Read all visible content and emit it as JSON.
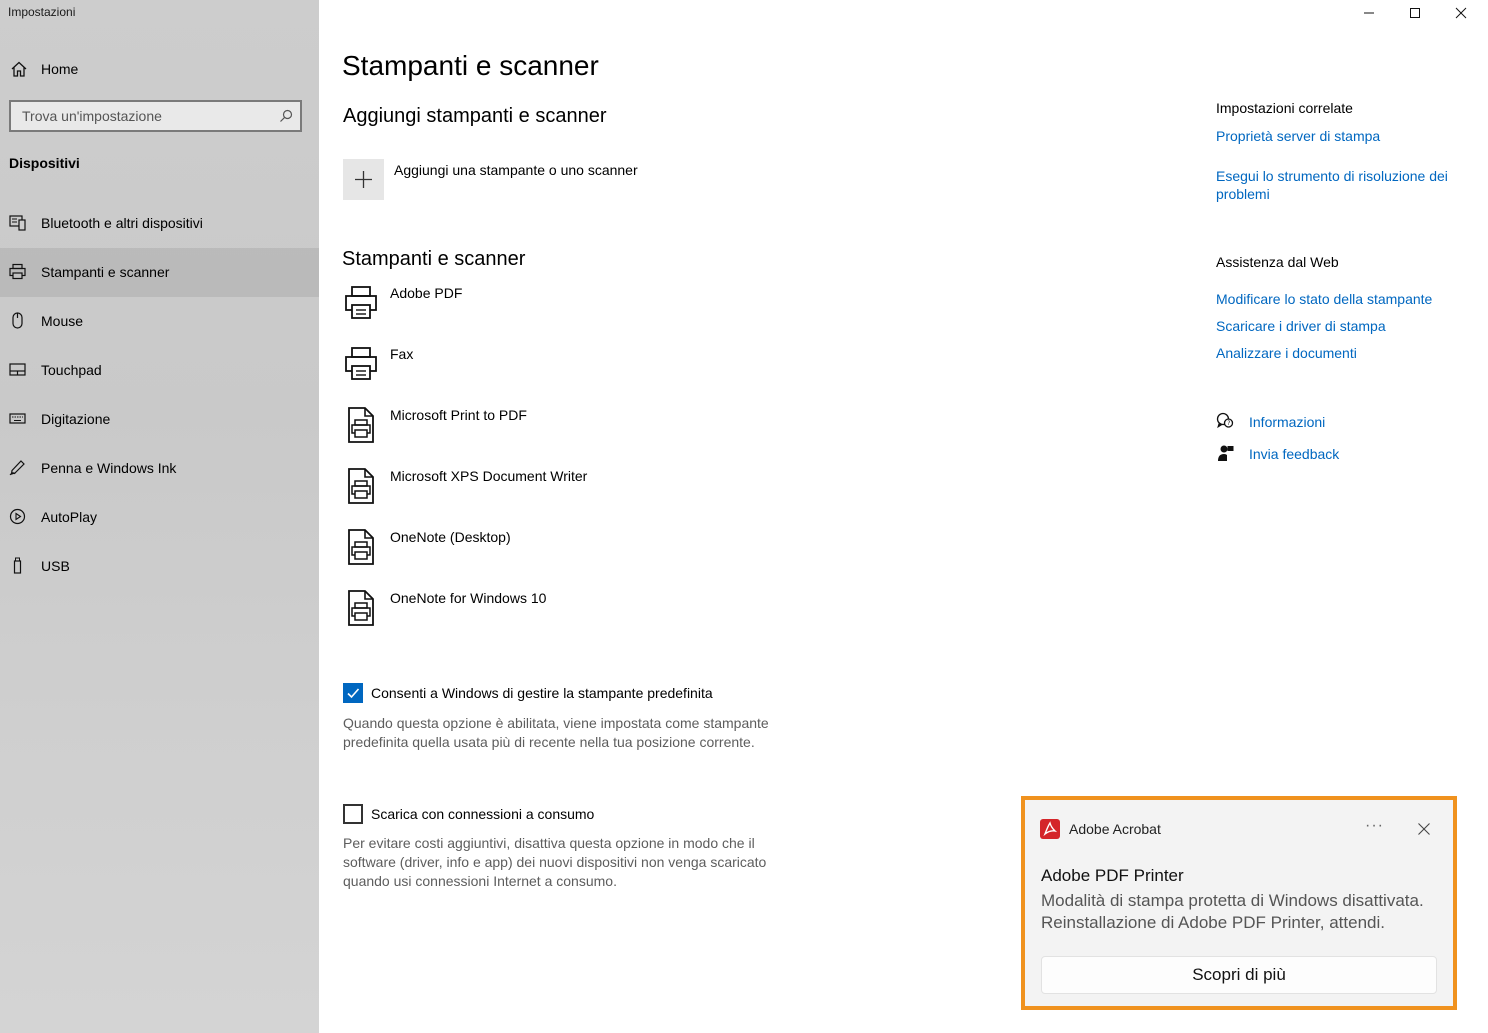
{
  "window": {
    "title": "Impostazioni",
    "controls": [
      "minimize-icon",
      "maximize-icon",
      "close-icon"
    ]
  },
  "sidebar": {
    "home_label": "Home",
    "search_placeholder": "Trova un'impostazione",
    "section_title": "Dispositivi",
    "items": [
      {
        "label": "Bluetooth e altri dispositivi",
        "icon": "bluetooth-devices-icon",
        "selected": false
      },
      {
        "label": "Stampanti e scanner",
        "icon": "printer-icon",
        "selected": true
      },
      {
        "label": "Mouse",
        "icon": "mouse-icon",
        "selected": false
      },
      {
        "label": "Touchpad",
        "icon": "touchpad-icon",
        "selected": false
      },
      {
        "label": "Digitazione",
        "icon": "keyboard-icon",
        "selected": false
      },
      {
        "label": "Penna e Windows Ink",
        "icon": "pen-icon",
        "selected": false
      },
      {
        "label": "AutoPlay",
        "icon": "autoplay-icon",
        "selected": false
      },
      {
        "label": "USB",
        "icon": "usb-icon",
        "selected": false
      }
    ]
  },
  "main": {
    "title": "Stampanti e scanner",
    "add_section_title": "Aggiungi stampanti e scanner",
    "add_button_label": "Aggiungi una stampante o uno scanner",
    "printers_section_title": "Stampanti e scanner",
    "printers": [
      {
        "name": "Adobe PDF",
        "icon": "printer-icon"
      },
      {
        "name": "Fax",
        "icon": "printer-icon"
      },
      {
        "name": "Microsoft Print to PDF",
        "icon": "document-printer-icon"
      },
      {
        "name": "Microsoft XPS Document Writer",
        "icon": "document-printer-icon"
      },
      {
        "name": "OneNote (Desktop)",
        "icon": "document-printer-icon"
      },
      {
        "name": "OneNote for Windows 10",
        "icon": "document-printer-icon"
      }
    ],
    "default_printer": {
      "checked": true,
      "label": "Consenti a Windows di gestire la stampante predefinita",
      "description": "Quando questa opzione è abilitata, viene impostata come stampante predefinita quella usata più di recente nella tua posizione corrente."
    },
    "metered": {
      "checked": false,
      "label": "Scarica con connessioni a consumo",
      "description": "Per evitare costi aggiuntivi, disattiva questa opzione in modo che il software (driver, info e app) dei nuovi dispositivi non venga scaricato quando usi connessioni Internet a consumo."
    }
  },
  "related": {
    "heading": "Impostazioni correlate",
    "links": [
      "Proprietà server di stampa",
      "Esegui lo strumento di risoluzione dei problemi"
    ],
    "web_heading": "Assistenza dal Web",
    "web_links": [
      "Modificare lo stato della stampante",
      "Scaricare i driver di stampa",
      "Analizzare i documenti"
    ],
    "help_label": "Informazioni",
    "feedback_label": "Invia feedback"
  },
  "toast": {
    "app_name": "Adobe Acrobat",
    "more_label": "···",
    "title": "Adobe PDF Printer",
    "body": "Modalità di stampa protetta di Windows disattivata. Reinstallazione di Adobe PDF Printer, attendi.",
    "button_label": "Scopri di più",
    "highlight_color": "#f0921e"
  },
  "colors": {
    "accent": "#0067c0",
    "sidebar_bg": "#cdcdcd",
    "acrobat_red": "#d4252a"
  }
}
